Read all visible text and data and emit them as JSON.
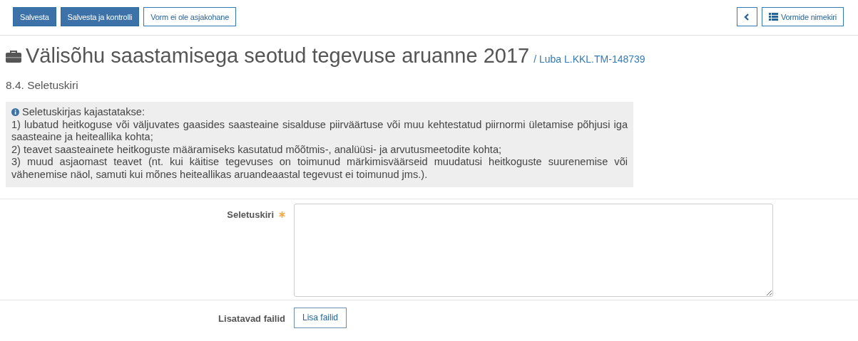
{
  "toolbar": {
    "left_buttons": [
      {
        "label": "Salvesta",
        "kind": "primary"
      },
      {
        "label": "Salvesta ja kontrolli",
        "kind": "primary"
      },
      {
        "label": "Vorm ei ole asjakohane",
        "kind": "default"
      }
    ],
    "back_button": {
      "kind": "back"
    },
    "list_button": {
      "label": "Vormide nimekiri"
    }
  },
  "page_title": {
    "title": "Välisõhu saastamisega seotud tegevuse aruanne 2017",
    "permit_link": "/ Luba L.KKL.TM-148739"
  },
  "section_title": "8.4. Seletuskiri",
  "info_box": {
    "heading": "Seletuskirjas kajastatakse:",
    "items": [
      "1) lubatud heitkoguse või väljuvates gaasides saasteaine sisalduse piirväärtuse või muu kehtestatud piirnormi ületamise põhjusi iga saasteaine ja heiteallika kohta;",
      "2) teavet saasteainete heitkoguste määramiseks kasutatud mõõtmis-, analüüsi- ja arvutusmeetodite kohta;",
      "3) muud asjaomast teavet (nt. kui käitise tegevuses on toimunud märkimisväärseid muudatusi heitkoguste suurenemise või vähenemise näol, samuti kui mõnes heiteallikas aruandeaastal tegevust ei toimunud jms.)."
    ]
  },
  "form": {
    "fields": [
      {
        "label": "Seletuskiri",
        "required": true,
        "kind": "textarea"
      },
      {
        "label": "Lisatavad failid",
        "required": false,
        "kind": "upload",
        "button": "Lisa failid"
      }
    ]
  }
}
